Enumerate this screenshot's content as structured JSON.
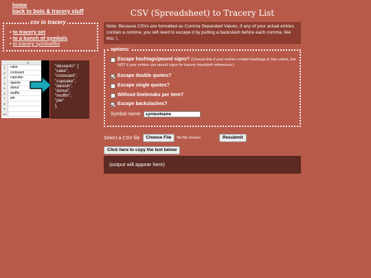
{
  "nav": {
    "home": "home",
    "back": "back to bots & tracery stuff"
  },
  "sidebar": {
    "legend": "csv to tracery",
    "items": [
      {
        "label": "to tracery set",
        "current": false
      },
      {
        "label": "to a bunch of symbols",
        "current": false
      },
      {
        "label": "to tracery symbol/list",
        "current": true
      }
    ]
  },
  "example": {
    "column_header": "A",
    "rows": [
      {
        "n": "1",
        "v": "cake"
      },
      {
        "n": "2",
        "v": "croissant"
      },
      {
        "n": "3",
        "v": "cupcake"
      },
      {
        "n": "4",
        "v": "danish"
      },
      {
        "n": "5",
        "v": "donut"
      },
      {
        "n": "6",
        "v": "muffin"
      },
      {
        "n": "7",
        "v": "pie"
      },
      {
        "n": "8",
        "v": ""
      },
      {
        "n": "9",
        "v": ""
      },
      {
        "n": "10",
        "v": ""
      }
    ],
    "code_lines": [
      "\"desserts\": [",
      "\"cake\",",
      "\"croissant\",",
      "\"cupcake\",",
      "\"danish\",",
      "\"donut\",",
      "\"muffin\",",
      "\"pie\"",
      "],"
    ]
  },
  "main": {
    "title": "CSV (Spreadsheet) to Tracery List",
    "note": "Note: Because CSVs are formatted as Comma Separated Values, if any of your actual entries contain a comma, you will need to escape it by putting a backslash before each comma, like this: \\,",
    "options_legend": "options:",
    "options": [
      {
        "label": "Escape hashtags/pound signs?",
        "hint": "(Choose this if your entries contain hashtags or hex colors, but NOT if your entries use pound signs for tracery #symbol# references.)",
        "checked": false
      },
      {
        "label": "Escape double quotes?",
        "hint": "",
        "checked": true
      },
      {
        "label": "Escape single quotes?",
        "hint": "",
        "checked": false
      },
      {
        "label": "Without linebreaks per item?",
        "hint": "",
        "checked": false
      },
      {
        "label": "Escape backslashes?",
        "hint": "",
        "checked": true
      }
    ],
    "symbol_label": "Symbol name:",
    "symbol_value": "symbolName",
    "csv_label": "Select a CSV file",
    "choose_file": "Choose File",
    "no_file": "No file chosen",
    "resubmit": "Resubmit",
    "copy_button": "Click here to copy the text below",
    "output_placeholder": "(output will appear here)"
  },
  "colors": {
    "background": "#b85a4a",
    "panel_dark": "#5c2a22",
    "note_bg": "#8c3d30",
    "arrow": "#1aa6b7"
  }
}
